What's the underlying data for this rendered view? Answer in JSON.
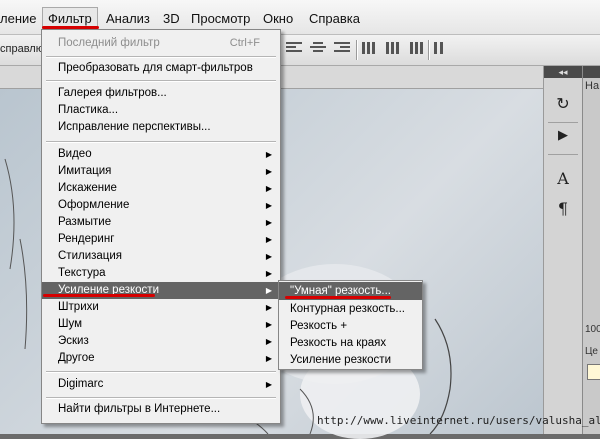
{
  "menubar": {
    "items": [
      "ление",
      "Фильтр",
      "Анализ",
      "3D",
      "Просмотр",
      "Окно",
      "Справка"
    ]
  },
  "optionsbar": {
    "left_text": "справлю"
  },
  "filter_menu": {
    "last_filter": {
      "label": "Последний фильтр",
      "shortcut": "Ctrl+F"
    },
    "convert_smart": "Преобразовать для смарт-фильтров",
    "gallery": "Галерея фильтров...",
    "liquify": "Пластика...",
    "perspective": "Исправление перспективы...",
    "categories": [
      "Видео",
      "Имитация",
      "Искажение",
      "Оформление",
      "Размытие",
      "Рендеринг",
      "Стилизация",
      "Текстура",
      "Усиление резкости",
      "Штрихи",
      "Шум",
      "Эскиз",
      "Другое"
    ],
    "digimarc": "Digimarc",
    "browse": "Найти фильтры в Интернете..."
  },
  "submenu": {
    "items": [
      "\"Умная\" резкость...",
      "Контурная резкость...",
      "Резкость +",
      "Резкость на краях",
      "Усиление резкости"
    ]
  },
  "right_panel": {
    "collapse_glyph": "◂◂",
    "header_text": "На",
    "value_text": "100",
    "label_text": "Це"
  },
  "colors": {
    "highlight": "#646464",
    "annotation_red": "#d60000"
  },
  "watermark": "http://www.liveinternet.ru/users/valusha_alex/"
}
